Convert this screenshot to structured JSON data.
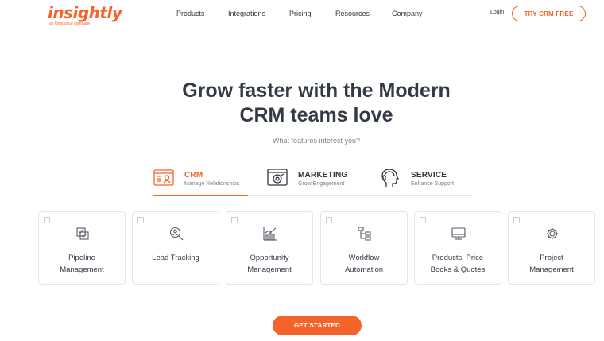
{
  "brand": {
    "logo_text": "insightly",
    "logo_subtext": "an Unbounce company",
    "accent": "#f4632a"
  },
  "nav": {
    "items": [
      "Products",
      "Integrations",
      "Pricing",
      "Resources",
      "Company"
    ],
    "login": "Login",
    "cta": "TRY CRM FREE"
  },
  "hero": {
    "title_line1": "Grow faster with the Modern",
    "title_line2": "CRM teams love",
    "question": "What features interest you?"
  },
  "tabs": [
    {
      "title": "CRM",
      "subtitle": "Manage Relationships",
      "icon": "crm-icon",
      "active": true
    },
    {
      "title": "MARKETING",
      "subtitle": "Grow Engagement",
      "icon": "marketing-icon",
      "active": false
    },
    {
      "title": "SERVICE",
      "subtitle": "Enhance Support",
      "icon": "service-icon",
      "active": false
    }
  ],
  "features": [
    {
      "line1": "Pipeline",
      "line2": "Management",
      "icon": "checklist-icon"
    },
    {
      "line1": "Lead Tracking",
      "line2": "",
      "icon": "lead-search-icon"
    },
    {
      "line1": "Opportunity",
      "line2": "Management",
      "icon": "chart-icon"
    },
    {
      "line1": "Workflow",
      "line2": "Automation",
      "icon": "workflow-icon"
    },
    {
      "line1": "Products, Price",
      "line2": "Books & Quotes",
      "icon": "monitor-icon"
    },
    {
      "line1": "Project",
      "line2": "Management",
      "icon": "gear-network-icon"
    }
  ],
  "cta_button": "GET STARTED"
}
